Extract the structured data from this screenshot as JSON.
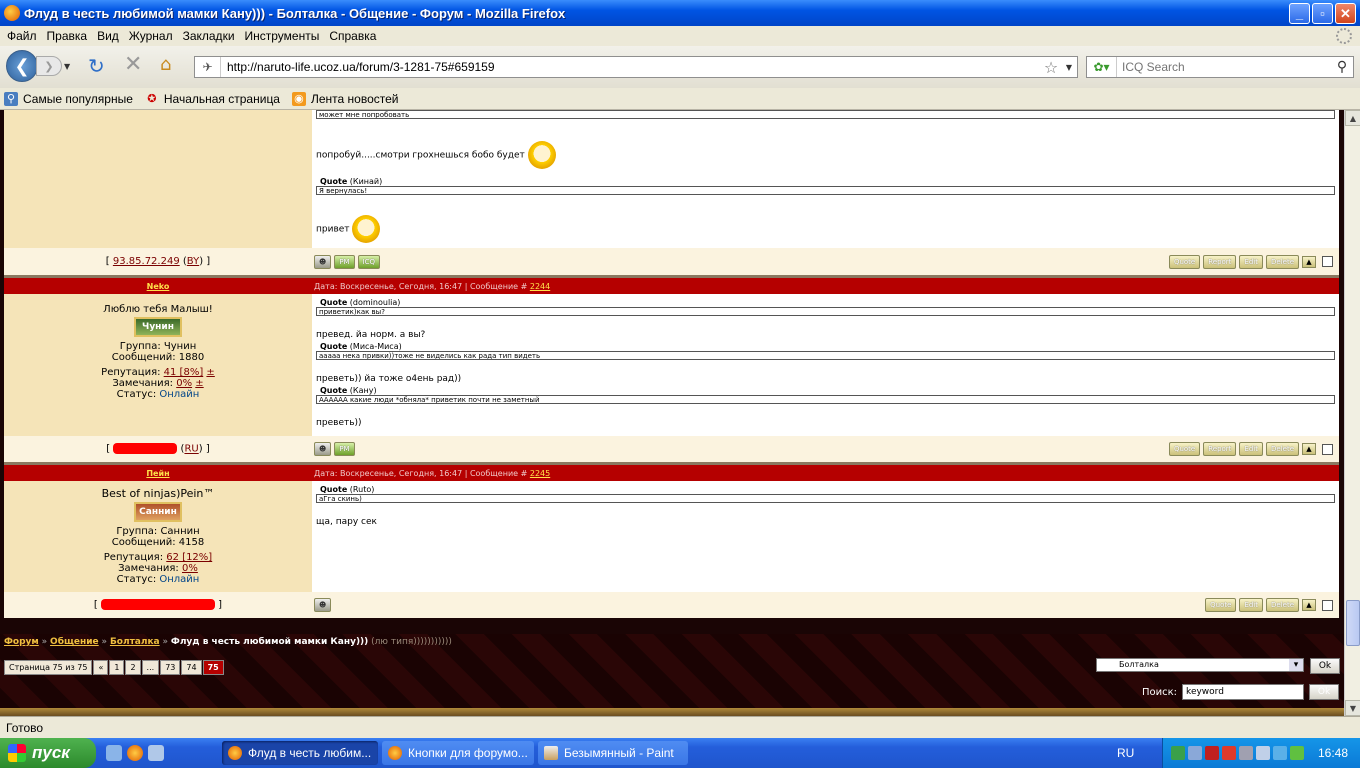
{
  "window": {
    "title": "Флуд в честь любимой мамки Кану))) - Болталка - Общение - Форум - Mozilla Firefox",
    "min": "_",
    "max": "▫",
    "close": "✕"
  },
  "menu": [
    "Файл",
    "Правка",
    "Вид",
    "Журнал",
    "Закладки",
    "Инструменты",
    "Справка"
  ],
  "nav": {
    "url": "http://naruto-life.ucoz.ua/forum/3-1281-75#659159",
    "search_placeholder": "ICQ Search"
  },
  "bookmarks": [
    "Самые популярные",
    "Начальная страница",
    "Лента новостей"
  ],
  "post1": {
    "quote0_text": "может мне попробовать",
    "msg1": "попробуй.....смотри грохнешься бобо будет",
    "quote1_label": "Quote",
    "quote1_author": "(Кинай)",
    "quote1_text": "Я вернулась!",
    "msg2": "привет",
    "ip": "93.85.72.249",
    "country": "BY",
    "buttons": [
      "PM",
      "ICQ"
    ],
    "actions": [
      "Quote",
      "Report",
      "Edit",
      "Delete"
    ]
  },
  "post2": {
    "nick": "Neko",
    "date": "Дата: Воскресенье, Сегодня, 16:47 | Сообщение #",
    "num": "2244",
    "motto": "Люблю тебя Малыш!",
    "rank": "Чунин",
    "group": "Группа: Чунин",
    "messages": "Сообщений: 1880",
    "rep_label": "Репутация:",
    "rep_value": "41 [8%]",
    "warn_label": "Замечания:",
    "warn_value": "0%",
    "status_label": "Статус:",
    "status_value": "Онлайн",
    "pm_suffix": "±",
    "q1_label": "Quote",
    "q1_author": "(dominoulia)",
    "q1_text": "приветик)как вы?",
    "m1": "превед. йа норм. а вы?",
    "q2_label": "Quote",
    "q2_author": "(Миса-Миса)",
    "q2_text": "ааааа нека привки))тоже не виделись как рада тип видеть",
    "m2": "преветь)) йа тоже о4ень рад))",
    "q3_label": "Quote",
    "q3_author": "(Кану)",
    "q3_text": "АААААА какие люди *обняла* приветик почти не заметный",
    "m3": "преветь))",
    "country": "RU",
    "buttons": [
      "PM"
    ],
    "actions": [
      "Quote",
      "Report",
      "Edit",
      "Delete"
    ]
  },
  "post3": {
    "nick": "Пейн",
    "date": "Дата: Воскресенье, Сегодня, 16:47 | Сообщение #",
    "num": "2245",
    "motto": "Best of ninjas)Pein™",
    "rank": "Саннин",
    "group": "Группа: Саннин",
    "messages": "Сообщений: 4158",
    "rep_label": "Репутация:",
    "rep_value": "62 [12%]",
    "warn_label": "Замечания:",
    "warn_value": "0%",
    "status_label": "Статус:",
    "status_value": "Онлайн",
    "q1_label": "Quote",
    "q1_author": "(Ruto)",
    "q1_text": "аГга скинь)",
    "m1": "ща, пару сек",
    "actions": [
      "Quote",
      "Edit",
      "Delete"
    ]
  },
  "breadcrumb": {
    "forum": "Форум",
    "section": "Общение",
    "subforum": "Болталка",
    "sep": "»",
    "current": "Флуд в честь любимой мамки Кану)))",
    "subtitle": "(лю типя)))))))))))"
  },
  "pager": {
    "label": "Страница 75 из 75",
    "items": [
      "«",
      "1",
      "2",
      "...",
      "73",
      "74"
    ],
    "current": "75"
  },
  "jump": {
    "selected": "Болталка",
    "ok": "Ok"
  },
  "search": {
    "label": "Поиск:",
    "value": "keyword",
    "ok": "Ok"
  },
  "statusbar": "Готово",
  "taskbar": {
    "start": "пуск",
    "tasks": [
      "Флуд в честь любим...",
      "Кнопки для форумо...",
      "Безымянный - Paint"
    ],
    "lang": "RU",
    "time": "16:48"
  }
}
